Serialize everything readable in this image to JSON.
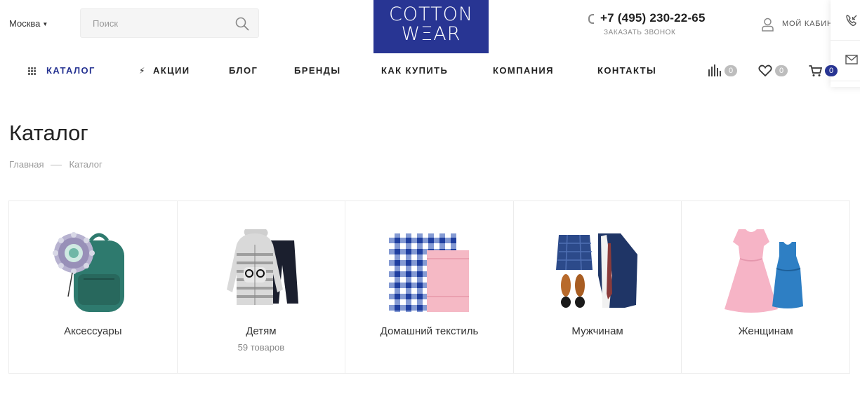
{
  "header": {
    "city": "Москва",
    "search": {
      "placeholder": "Поиск"
    },
    "logo": {
      "line1": "COTTON",
      "line2": "WΞAR"
    },
    "phone": "+7 (495) 230-22-65",
    "callback": "ЗАКАЗАТЬ ЗВОНОК",
    "cabinet": "МОЙ КАБИНЕТ"
  },
  "nav": {
    "items": [
      {
        "label": "КАТАЛОГ"
      },
      {
        "label": "АКЦИИ"
      },
      {
        "label": "БЛОГ"
      },
      {
        "label": "БРЕНДЫ"
      },
      {
        "label": "КАК КУПИТЬ"
      },
      {
        "label": "КОМПАНИЯ"
      },
      {
        "label": "КОНТАКТЫ"
      }
    ],
    "compare_count": "0",
    "favorites_count": "0",
    "cart_count": "0"
  },
  "page": {
    "title": "Каталог",
    "breadcrumb": [
      "Главная",
      "Каталог"
    ]
  },
  "categories": [
    {
      "name": "Аксессуары",
      "count": "",
      "icon": "backpack-icon"
    },
    {
      "name": "Детям",
      "count": "59 товаров",
      "icon": "kids-clothes-icon"
    },
    {
      "name": "Домашний текстиль",
      "count": "",
      "icon": "towels-icon"
    },
    {
      "name": "Мужчинам",
      "count": "",
      "icon": "mens-clothes-icon"
    },
    {
      "name": "Женщинам",
      "count": "",
      "icon": "dresses-icon"
    }
  ],
  "colors": {
    "brand": "#283593",
    "badge": "#bdbdbd"
  }
}
